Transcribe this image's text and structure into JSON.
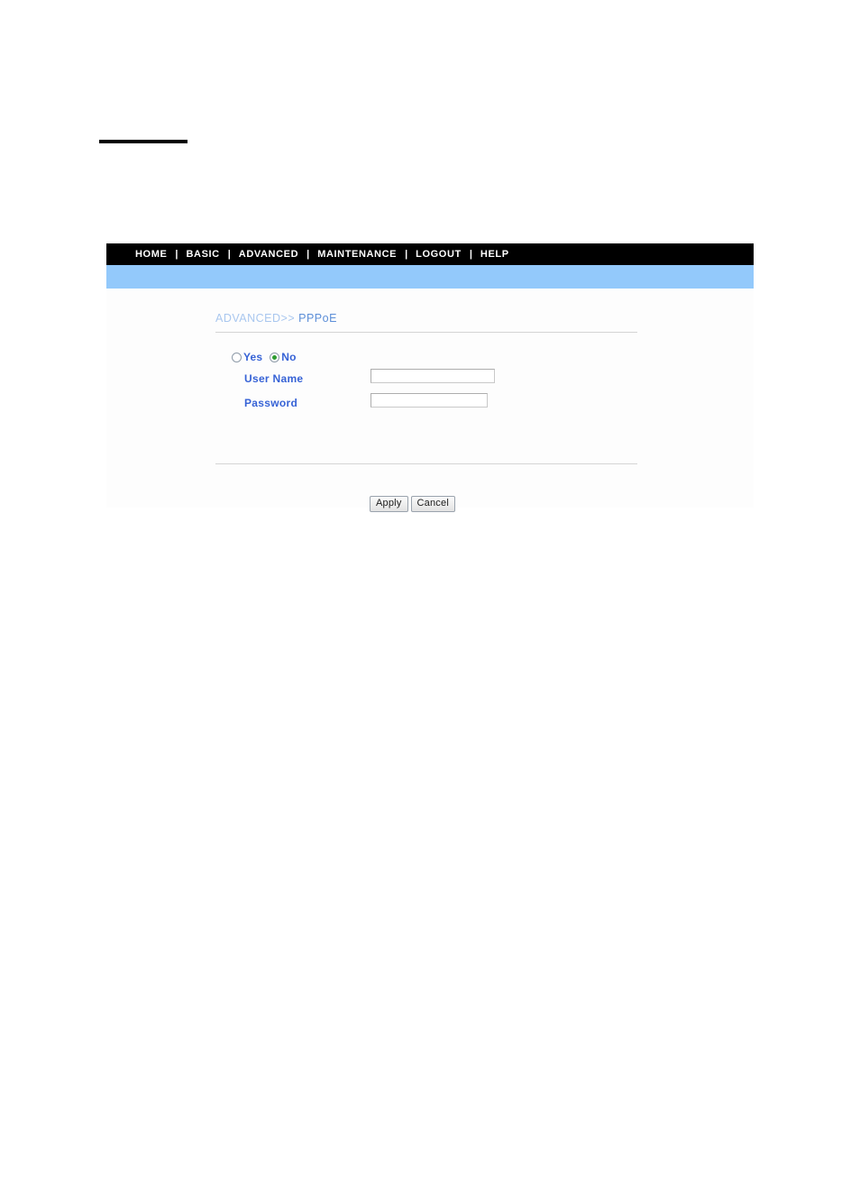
{
  "document": {
    "redacted_rule": ""
  },
  "router_ui": {
    "nav": {
      "separator": "|",
      "items": [
        {
          "label": "HOME",
          "name": "nav-item-home"
        },
        {
          "label": "BASIC",
          "name": "nav-item-basic"
        },
        {
          "label": "ADVANCED",
          "name": "nav-item-advanced"
        },
        {
          "label": "MAINTENANCE",
          "name": "nav-item-maintenance"
        },
        {
          "label": "LOGOUT",
          "name": "nav-item-logout"
        },
        {
          "label": "HELP",
          "name": "nav-item-help"
        }
      ]
    },
    "breadcrumb": {
      "parent": "ADVANCED>>",
      "current": "PPPoE"
    },
    "form": {
      "enable_radio": {
        "yes_label": "Yes",
        "no_label": "No",
        "selected": "No"
      },
      "username": {
        "label": "User Name",
        "value": "",
        "placeholder": ""
      },
      "password": {
        "label": "Password",
        "value": "",
        "placeholder": ""
      }
    },
    "buttons": {
      "apply": "Apply",
      "cancel": "Cancel"
    },
    "colors": {
      "navbar_bg": "#000000",
      "subbar_bg": "#93c9fb",
      "label_blue": "#3763d6",
      "crumb_parent": "#a9c7ef",
      "crumb_current": "#5d8fd8",
      "radio_selected_dot": "#2e9b30"
    }
  }
}
